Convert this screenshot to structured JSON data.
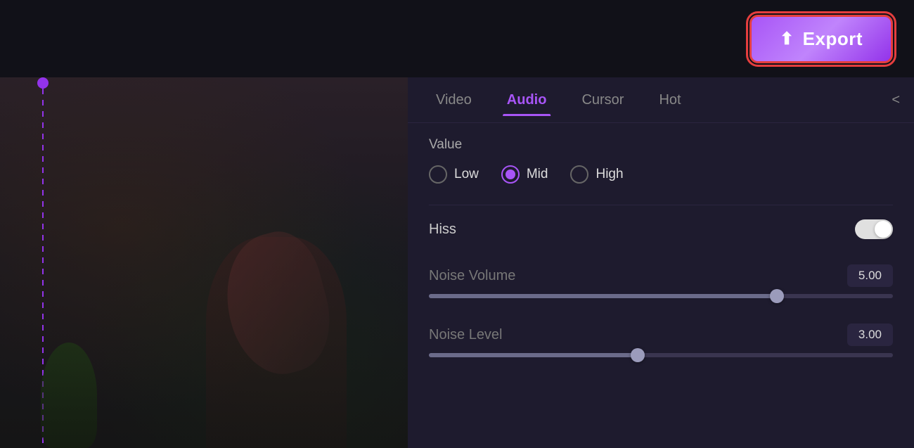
{
  "topbar": {
    "export_label": "Export",
    "export_icon": "⬆"
  },
  "tabs": {
    "items": [
      {
        "id": "video",
        "label": "Video",
        "active": false
      },
      {
        "id": "audio",
        "label": "Audio",
        "active": true
      },
      {
        "id": "cursor",
        "label": "Cursor",
        "active": false
      },
      {
        "id": "hot",
        "label": "Hot",
        "active": false
      }
    ],
    "chevron_label": "<"
  },
  "panel": {
    "value_label": "Value",
    "radio_options": [
      {
        "id": "low",
        "label": "Low",
        "selected": false
      },
      {
        "id": "mid",
        "label": "Mid",
        "selected": true
      },
      {
        "id": "high",
        "label": "High",
        "selected": false
      }
    ],
    "hiss_label": "Hiss",
    "hiss_enabled": true,
    "noise_volume_label": "Noise Volume",
    "noise_volume_value": "5.00",
    "noise_volume_percent": 75,
    "noise_level_label": "Noise Level",
    "noise_level_value": "3.00",
    "noise_level_percent": 45
  }
}
